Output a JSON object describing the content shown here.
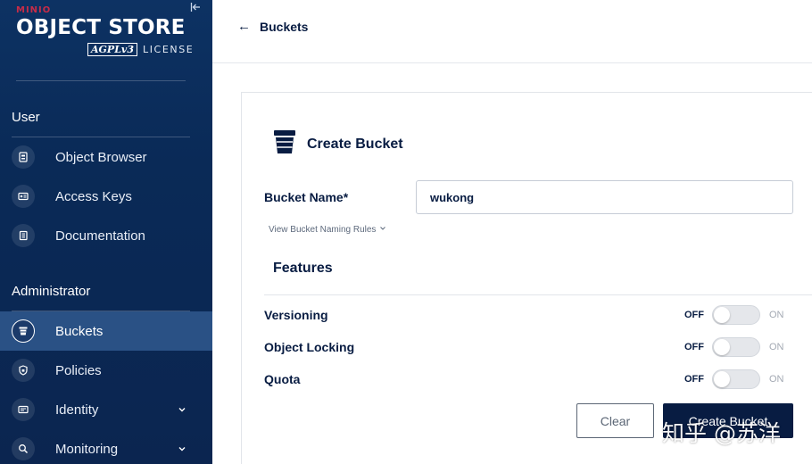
{
  "brand": {
    "vendor": "MINIO",
    "product": "OBJECT STORE",
    "license_badge": "AGPLv3",
    "license_word": "LICENSE"
  },
  "sidebar": {
    "sections": [
      {
        "title": "User",
        "items": [
          {
            "label": "Object Browser",
            "icon": "object-browser-icon",
            "active": false,
            "expandable": false
          },
          {
            "label": "Access Keys",
            "icon": "access-keys-icon",
            "active": false,
            "expandable": false
          },
          {
            "label": "Documentation",
            "icon": "documentation-icon",
            "active": false,
            "expandable": false
          }
        ]
      },
      {
        "title": "Administrator",
        "items": [
          {
            "label": "Buckets",
            "icon": "bucket-icon",
            "active": true,
            "expandable": false
          },
          {
            "label": "Policies",
            "icon": "policy-shield-icon",
            "active": false,
            "expandable": false
          },
          {
            "label": "Identity",
            "icon": "identity-card-icon",
            "active": false,
            "expandable": true
          },
          {
            "label": "Monitoring",
            "icon": "monitoring-search-icon",
            "active": false,
            "expandable": true
          }
        ]
      }
    ]
  },
  "header": {
    "back_label": "Buckets"
  },
  "form": {
    "title": "Create Bucket",
    "bucket_name_label": "Bucket Name*",
    "bucket_name_value": "wukong",
    "naming_rules_link": "View Bucket Naming Rules",
    "features_title": "Features",
    "features": [
      {
        "label": "Versioning",
        "off_label": "OFF",
        "on_label": "ON",
        "enabled": false
      },
      {
        "label": "Object Locking",
        "off_label": "OFF",
        "on_label": "ON",
        "enabled": false
      },
      {
        "label": "Quota",
        "off_label": "OFF",
        "on_label": "ON",
        "enabled": false
      }
    ],
    "clear_label": "Clear",
    "create_label": "Create Bucket"
  },
  "watermark": "知乎 @苏洋",
  "colors": {
    "sidebar_bg": "#0b2a57",
    "sidebar_active": "#2a5185",
    "primary": "#081c42",
    "brand_red": "#c72c48"
  }
}
